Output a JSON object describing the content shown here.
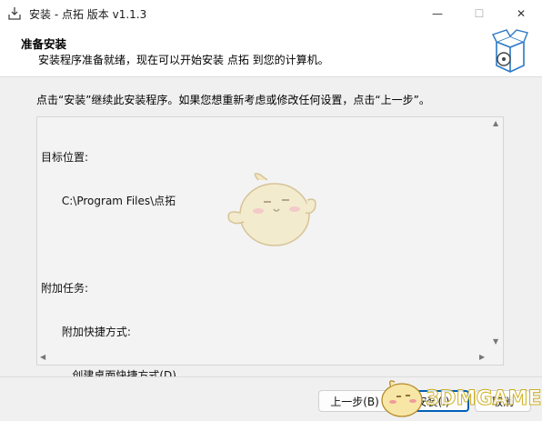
{
  "window": {
    "title": "安装 - 点拓 版本 v1.1.3",
    "icon": "installer-download-icon",
    "controls": {
      "minimize": "—",
      "maximize": "☐",
      "close": "✕"
    }
  },
  "header": {
    "title": "准备安装",
    "subtitle": "安装程序准备就绪，现在可以开始安装 点拓 到您的计算机。",
    "icon": "package-box-icon"
  },
  "main": {
    "instruction": "点击“安装”继续此安装程序。如果您想重新考虑或修改任何设置，点击“上一步”。",
    "memo": {
      "lines": [
        "目标位置:",
        "      C:\\Program Files\\点拓",
        "",
        "附加任务:",
        "      附加快捷方式:",
        "         创建桌面快捷方式(D)"
      ]
    }
  },
  "footer": {
    "back_label": "上一步(B)",
    "install_label": "安装(I)",
    "cancel_label": "取消"
  },
  "watermark": {
    "text": "3DMGAME"
  },
  "colors": {
    "accent": "#005fb8",
    "panel": "#f0f0f0",
    "memo_bg": "#f3f3f3"
  }
}
